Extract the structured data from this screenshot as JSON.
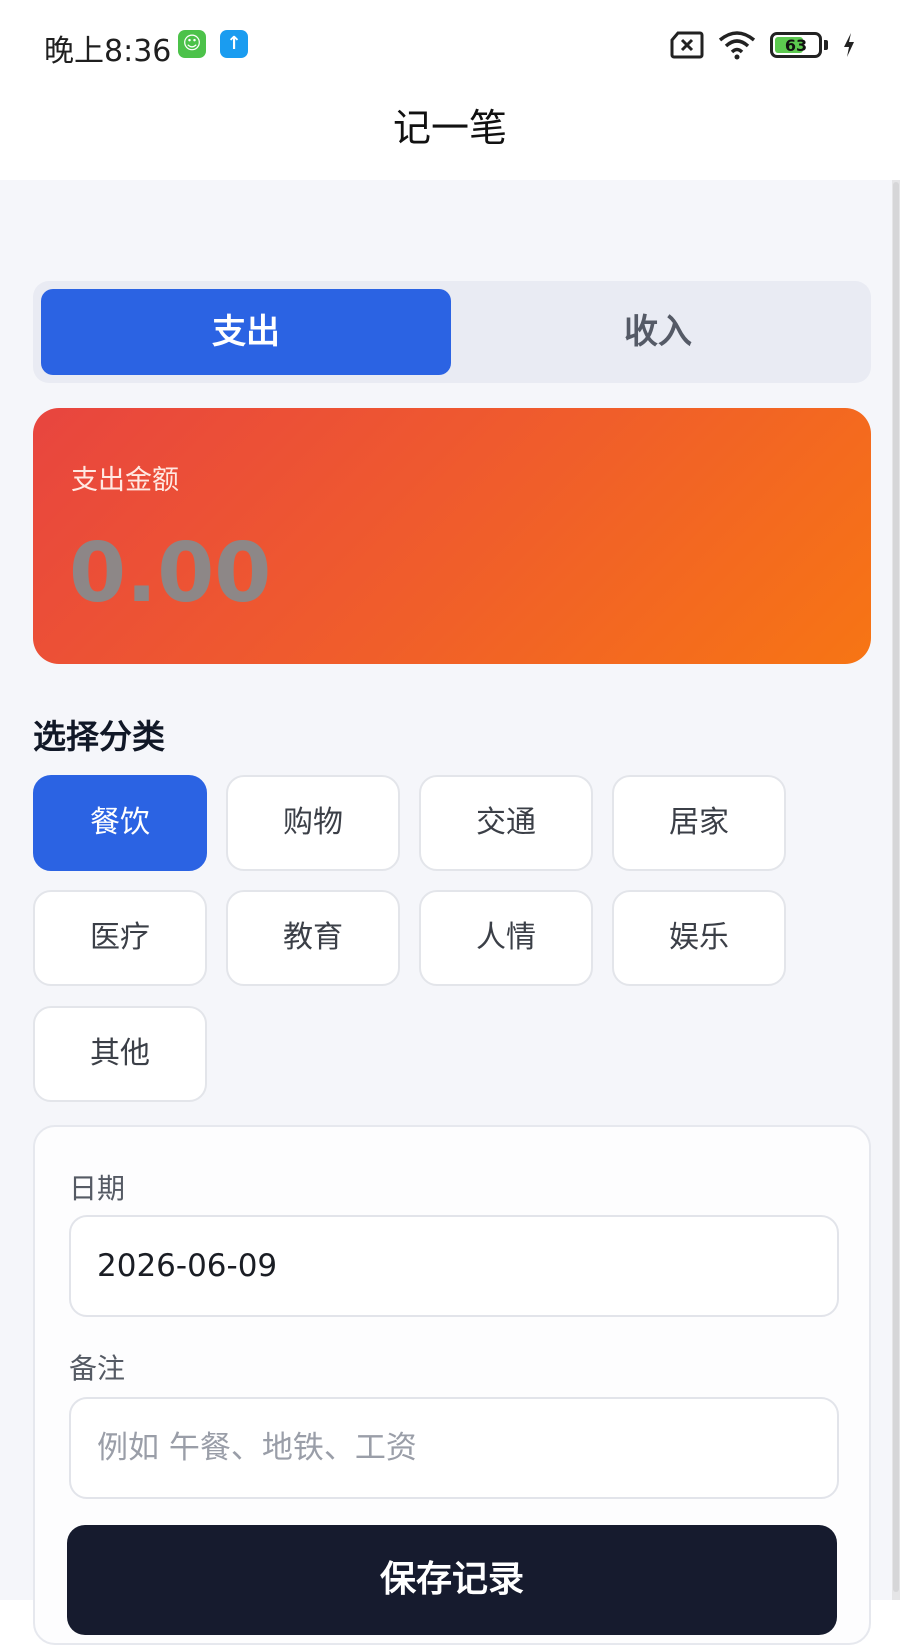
{
  "status_bar": {
    "time": "晚上8:36",
    "battery_percent": "63"
  },
  "header": {
    "title": "记一笔"
  },
  "type_toggle": {
    "expense": "支出",
    "income": "收入",
    "selected": "expense"
  },
  "amount_card": {
    "label": "支出金额",
    "value": "0.00"
  },
  "category_section": {
    "title": "选择分类",
    "items": [
      "餐饮",
      "购物",
      "交通",
      "居家",
      "医疗",
      "教育",
      "人情",
      "娱乐",
      "其他"
    ],
    "selected": "餐饮"
  },
  "form": {
    "date_label": "日期",
    "date_value": "2026-06-09",
    "note_label": "备注",
    "note_placeholder": "例如 午餐、地铁、工资"
  },
  "save_button": {
    "label": "保存记录"
  },
  "colors": {
    "primary": "#2b63e3",
    "card_gradient_start": "#e8453f",
    "card_gradient_end": "#f77514",
    "save_button": "#161b2e"
  }
}
